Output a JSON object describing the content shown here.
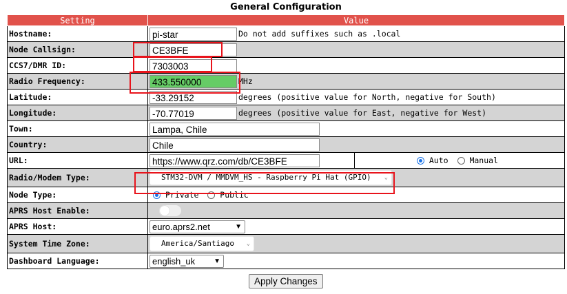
{
  "page_title": "General Configuration",
  "table": {
    "header_setting": "Setting",
    "header_value": "Value"
  },
  "rows": {
    "hostname": {
      "label": "Hostname:",
      "value": "pi-star",
      "hint": "Do not add suffixes such as .local"
    },
    "callsign": {
      "label": "Node Callsign:",
      "value": "CE3BFE"
    },
    "dmr_id": {
      "label": "CCS7/DMR ID:",
      "value": "7303003"
    },
    "frequency": {
      "label": "Radio Frequency:",
      "value": "433.550000",
      "unit": "MHz",
      "highlight_color": "#66cc66"
    },
    "latitude": {
      "label": "Latitude:",
      "value": "-33.29152",
      "hint": "degrees (positive value for North, negative for South)"
    },
    "longitude": {
      "label": "Longitude:",
      "value": "-70.77019",
      "hint": "degrees (positive value for East, negative for West)"
    },
    "town": {
      "label": "Town:",
      "value": "Lampa, Chile"
    },
    "country": {
      "label": "Country:",
      "value": "Chile"
    },
    "url": {
      "label": "URL:",
      "value": "https://www.qrz.com/db/CE3BFE",
      "radio_auto": "Auto",
      "radio_manual": "Manual",
      "selected": "Auto"
    },
    "modem": {
      "label": "Radio/Modem Type:",
      "value": "STM32-DVM / MMDVM_HS - Raspberry Pi Hat (GPIO)"
    },
    "node_type": {
      "label": "Node Type:",
      "radio_private": "Private",
      "radio_public": "Public",
      "selected": "Private"
    },
    "aprs_enable": {
      "label": "APRS Host Enable:",
      "enabled": false
    },
    "aprs_host": {
      "label": "APRS Host:",
      "value": "euro.aprs2.net"
    },
    "timezone": {
      "label": "System Time Zone:",
      "value": "America/Santiago"
    },
    "language": {
      "label": "Dashboard Language:",
      "value": "english_uk"
    }
  },
  "apply_button": "Apply Changes",
  "colors": {
    "header_bg": "#e1524b",
    "row_alt": "#d4d4d4",
    "annotation_red": "#e8131b",
    "radio_selected": "#1a73e8"
  }
}
